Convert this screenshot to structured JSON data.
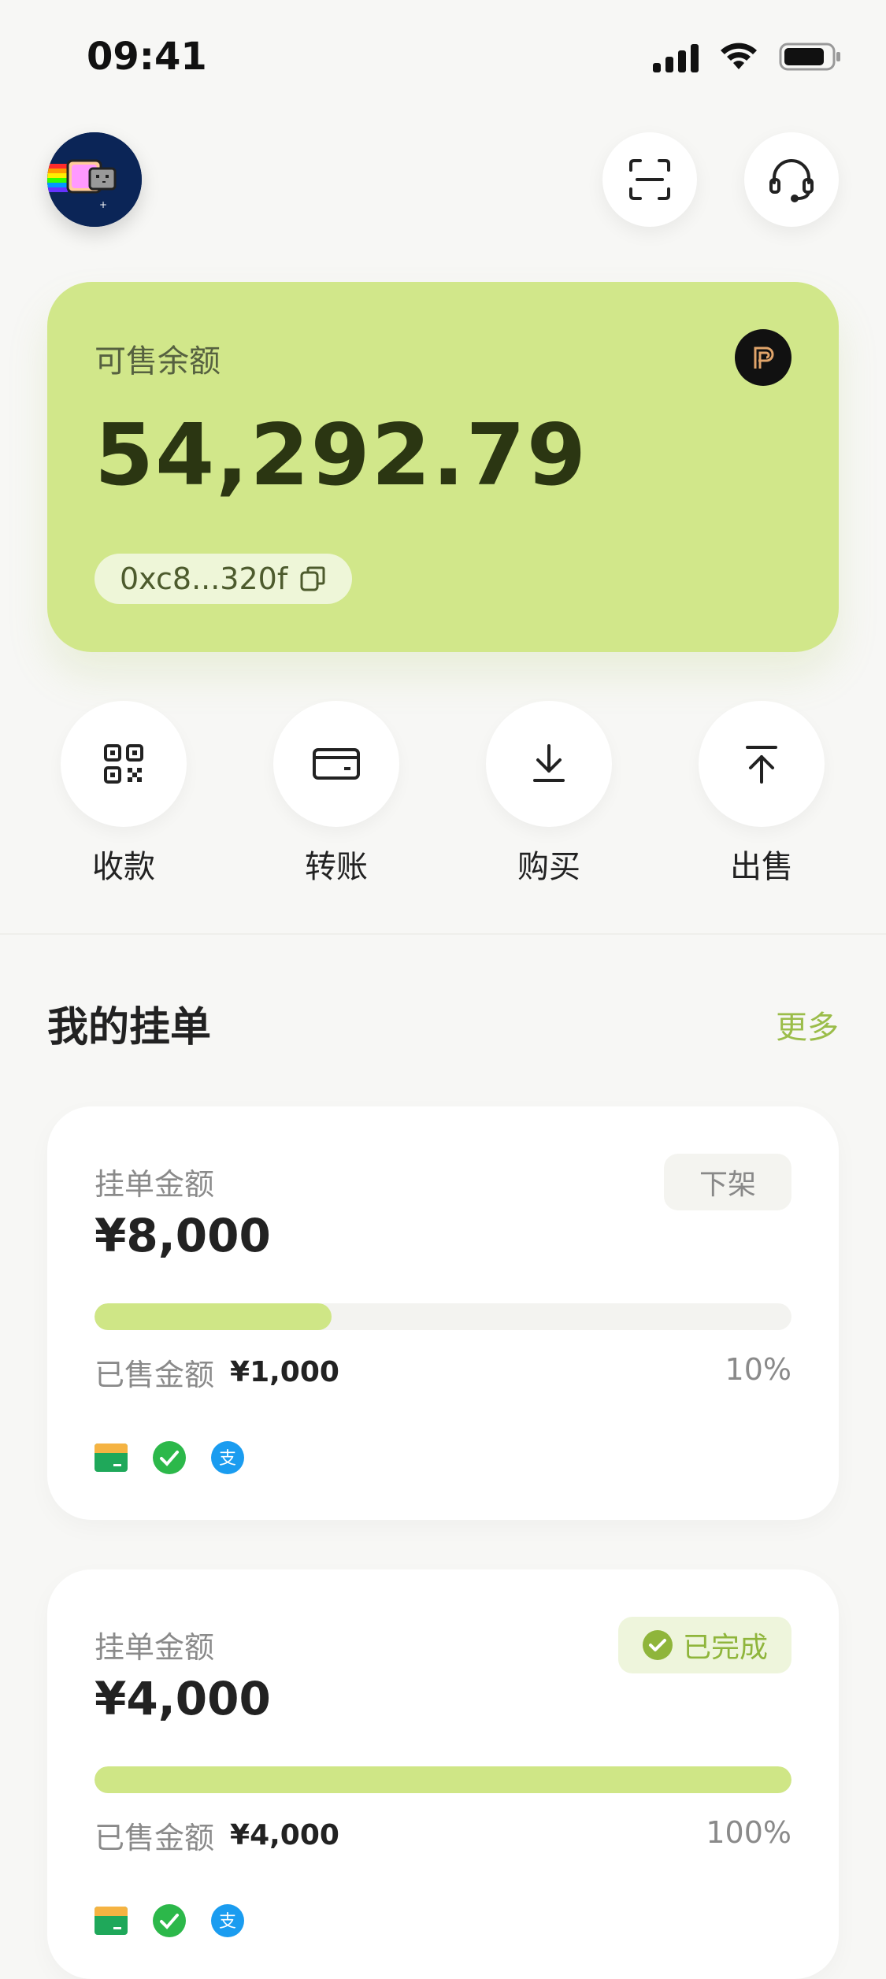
{
  "status_bar": {
    "time": "09:41"
  },
  "header": {
    "avatar_icon": "nyan-cat-avatar-icon",
    "scan_icon": "scan-icon",
    "support_icon": "headset-support-icon"
  },
  "balance_card": {
    "label": "可售余额",
    "amount": "54,292.79",
    "address": "0xc8...320f",
    "token_icon": "token-p-icon",
    "copy_icon": "copy-icon"
  },
  "actions": [
    {
      "label": "收款",
      "icon": "qr-code-icon"
    },
    {
      "label": "转账",
      "icon": "card-icon"
    },
    {
      "label": "购买",
      "icon": "download-arrow-icon"
    },
    {
      "label": "出售",
      "icon": "upload-arrow-icon"
    }
  ],
  "orders_section": {
    "title": "我的挂单",
    "more_label": "更多"
  },
  "orders": [
    {
      "amount_label": "挂单金额",
      "amount": "¥8,000",
      "action_label": "下架",
      "progress": 0.34,
      "sold_label": "已售金额",
      "sold_value": "¥1,000",
      "percent": "10%",
      "payment_methods": [
        "bank-card-icon",
        "wechat-icon",
        "alipay-icon"
      ]
    },
    {
      "amount_label": "挂单金额",
      "amount": "¥4,000",
      "status_label": "已完成",
      "progress": 1.0,
      "sold_label": "已售金额",
      "sold_value": "¥4,000",
      "percent": "100%",
      "payment_methods": [
        "bank-card-icon",
        "wechat-icon",
        "alipay-icon"
      ]
    }
  ],
  "colors": {
    "accent": "#d1e78a",
    "progress_fill": "#cfe686",
    "more_link": "#9bbd4a"
  }
}
